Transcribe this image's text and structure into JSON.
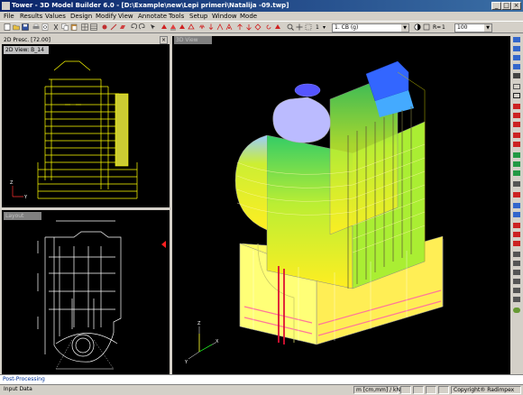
{
  "window": {
    "title": "Tower - 3D Model Builder 6.0 - [D:\\Example\\new\\Lepi primeri\\Natalija -09.twp]"
  },
  "menu": [
    "File",
    "Results",
    "Values",
    "Design",
    "Modify",
    "View",
    "Annotate",
    "Tools",
    "Setup",
    "Window",
    "Mode"
  ],
  "toolbar": {
    "step_value": "1",
    "load_case": "1. CB (g)",
    "r_label": "R=",
    "r_value": "1",
    "zoom_value": "100"
  },
  "panes": {
    "top_left_header": "2D Presc. [72.00]",
    "top_left_tab": "2D View: B_14",
    "bottom_left_tab": "Layout",
    "right_tab": "3D View"
  },
  "axes": {
    "x": "X",
    "y": "Y",
    "z": "Z"
  },
  "post_processing": "Post-Processing",
  "status": {
    "left": "Input Data",
    "units": "m [cm,mm] / kN",
    "copyright": "Copyright® Radimpex"
  },
  "colors": {
    "title_start": "#0a246a",
    "title_end": "#3a6ea5",
    "canvas": "#000000",
    "plan_lines": "#ffff00",
    "link_text": "#003399"
  }
}
